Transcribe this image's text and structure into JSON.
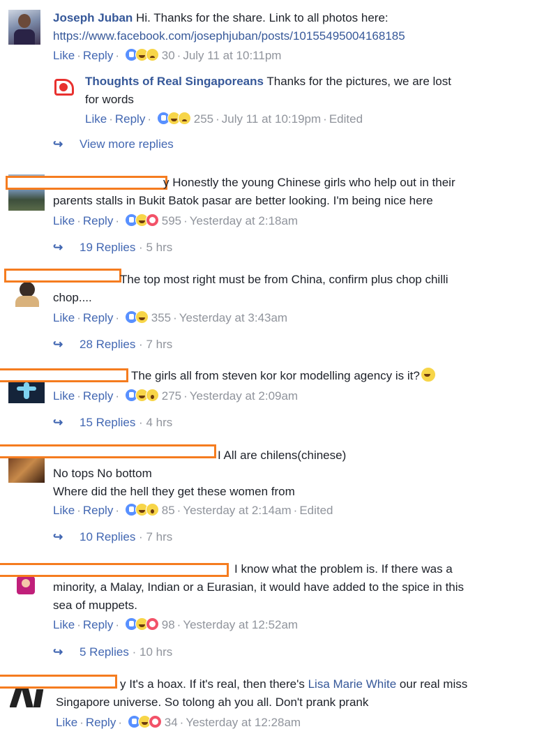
{
  "comments": [
    {
      "author": "Joseph Juban",
      "text": " Hi. Thanks for the share. Link to all photos here:",
      "link": "https://www.facebook.com/josephjuban/posts/10155495004168185",
      "like": "Like",
      "reply": "Reply",
      "reactions": [
        "like-icon",
        "haha-icon",
        "sad-icon"
      ],
      "count": "30",
      "time": "July 11 at 10:11pm"
    },
    {
      "author": "Thoughts of Real Singaporeans",
      "text_line1": " Thanks for the pictures, we are lost",
      "text_line2": "for words",
      "like": "Like",
      "reply": "Reply",
      "reactions": [
        "like-icon",
        "haha-icon",
        "sad-icon"
      ],
      "count": "255",
      "time": "July 11 at 10:19pm",
      "edited": "Edited",
      "view_more": "View more replies"
    },
    {
      "text_line1": "y Honestly the young Chinese girls who help out in their",
      "text_line2": "parents stalls in Bukit Batok pasar are better looking. I'm being nice here",
      "like": "Like",
      "reply": "Reply",
      "reactions": [
        "like-icon",
        "haha-icon",
        "love-icon"
      ],
      "count": "595",
      "time": "Yesterday at 2:18am",
      "replies": "19 Replies",
      "replies_time": "5 hrs"
    },
    {
      "text_line1": "The top most right must be from China, confirm plus chop chilli",
      "text_line2": "chop....",
      "like": "Like",
      "reply": "Reply",
      "reactions": [
        "like-icon",
        "haha-icon"
      ],
      "count": "355",
      "time": "Yesterday at 3:43am",
      "replies": "28 Replies",
      "replies_time": "7 hrs"
    },
    {
      "text_line1": "The girls all from steven kor kor modelling agency is it?",
      "like": "Like",
      "reply": "Reply",
      "reactions": [
        "like-icon",
        "haha-icon",
        "wow-icon"
      ],
      "count": "275",
      "time": "Yesterday at 2:09am",
      "replies": "15 Replies",
      "replies_time": "4 hrs"
    },
    {
      "text_line1": "I All are chilens(chinese)",
      "text_line2": "No tops No bottom",
      "text_line3": "Where did the hell they get these women from",
      "like": "Like",
      "reply": "Reply",
      "reactions": [
        "like-icon",
        "haha-icon",
        "wow-icon"
      ],
      "count": "85",
      "time": "Yesterday at 2:14am",
      "edited": "Edited",
      "replies": "10 Replies",
      "replies_time": "7 hrs"
    },
    {
      "text_line1": "I know what the problem is. If there was a",
      "text_line2": "minority, a Malay, Indian or a Eurasian, it would have added to the spice in this",
      "text_line3": "sea of muppets.",
      "like": "Like",
      "reply": "Reply",
      "reactions": [
        "like-icon",
        "haha-icon",
        "love-icon"
      ],
      "count": "98",
      "time": "Yesterday at 12:52am",
      "replies": "5 Replies",
      "replies_time": "10 hrs"
    },
    {
      "text_line1_a": "y It's a hoax. If it's real, then there's ",
      "mention": "Lisa Marie White",
      "text_line1_b": " our real miss",
      "text_line2": "Singapore universe. So tolong ah you all. Don't prank prank",
      "like": "Like",
      "reply": "Reply",
      "reactions": [
        "like-icon",
        "haha-icon",
        "love-icon"
      ],
      "count": "34",
      "time": "Yesterday at 12:28am"
    }
  ],
  "colors": {
    "link": "#365899",
    "action": "#4267b2",
    "meta": "#90949c",
    "redaction": "#f57c1f"
  }
}
